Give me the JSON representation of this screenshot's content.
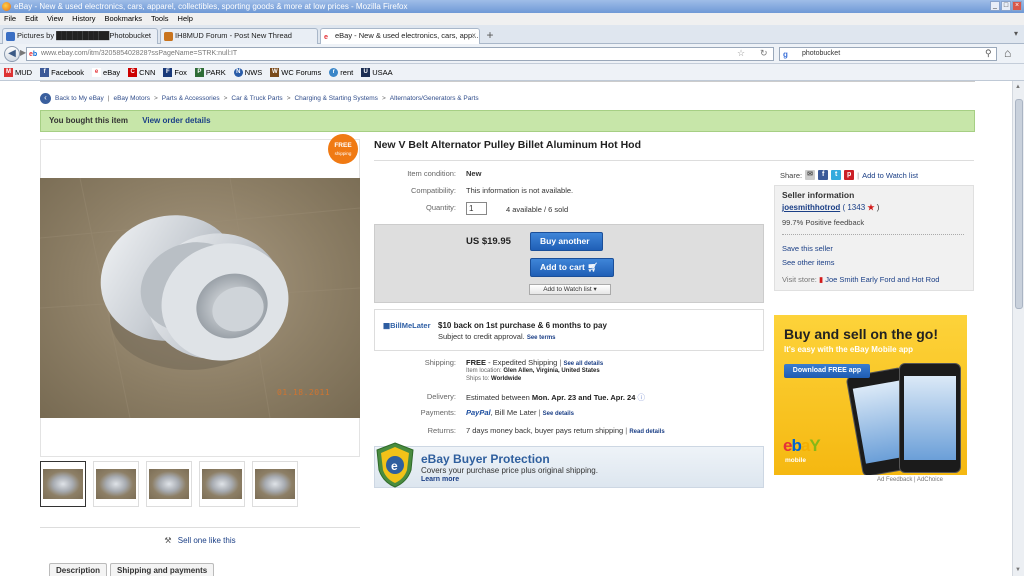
{
  "window": {
    "title": "eBay - New & used electronics, cars, apparel, collectibles, sporting goods & more at low prices - Mozilla Firefox",
    "controls": [
      "_",
      "□",
      "×"
    ]
  },
  "menu": [
    "File",
    "Edit",
    "View",
    "History",
    "Bookmarks",
    "Tools",
    "Help"
  ],
  "tabs": [
    {
      "label": "Pictures by ██████████Photobucket",
      "active": false
    },
    {
      "label": "IH8MUD Forum - Post New Thread",
      "active": false
    },
    {
      "label": "eBay - New & used electronics, cars, app...",
      "active": true
    }
  ],
  "nav": {
    "url": "www.ebay.com/itm/320585402828?ssPageName=STRK:null:IT",
    "search": "photobucket"
  },
  "bookmarks": [
    {
      "label": "MUD",
      "color": "#d33"
    },
    {
      "label": "Facebook",
      "color": "#3b5998"
    },
    {
      "label": "eBay",
      "color": "#e53238"
    },
    {
      "label": "CNN",
      "color": "#cc0000"
    },
    {
      "label": "Fox",
      "color": "#1a3a7a"
    },
    {
      "label": "PARK",
      "color": "#2e6c36"
    },
    {
      "label": "NWS",
      "color": "#2a5ca8"
    },
    {
      "label": "WC Forums",
      "color": "#7a4a1a"
    },
    {
      "label": "rent",
      "color": "#3a86c8"
    },
    {
      "label": "USAA",
      "color": "#1b2d52"
    }
  ],
  "breadcrumb": {
    "back": "Back to My eBay",
    "items": [
      "eBay Motors",
      "Parts & Accessories",
      "Car & Truck Parts",
      "Charging & Starting Systems",
      "Alternators/Generators & Parts"
    ]
  },
  "banner": {
    "text": "You bought this item",
    "link": "View order details"
  },
  "listing": {
    "title": "New V Belt Alternator Pulley Billet Aluminum Hot Hod",
    "free_badge": {
      "line1": "FREE",
      "line2": "shipping"
    },
    "image_stamp": "01.18.2011",
    "item_condition": {
      "label": "Item condition:",
      "value": "New"
    },
    "compatibility": {
      "label": "Compatibility:",
      "value": "This information is not available."
    },
    "quantity": {
      "label": "Quantity:",
      "value": "1",
      "available": "4 available / 6 sold"
    },
    "price": "US $19.95",
    "buttons": {
      "buy_another": "Buy another",
      "add_to_cart": "Add to cart",
      "watch": "Add to Watch list"
    },
    "bml": {
      "logo": "BillMeLater",
      "offer": "$10 back on 1st purchase & 6 months to pay",
      "sub": "Subject to credit approval.",
      "terms": "See terms"
    },
    "shipping": {
      "label": "Shipping:",
      "value": "FREE",
      "method": "- Expedited Shipping",
      "details_link": "See all details",
      "location_label": "Item location:",
      "location": "Glen Allen, Virginia, United States",
      "ships_to_label": "Ships to:",
      "ships_to": "Worldwide"
    },
    "delivery": {
      "label": "Delivery:",
      "prefix": "Estimated between",
      "range": "Mon. Apr. 23 and Tue. Apr. 24"
    },
    "payments": {
      "label": "Payments:",
      "paypal": "PayPal",
      "others": ", Bill Me Later",
      "details_link": "See details"
    },
    "returns": {
      "label": "Returns:",
      "value": "7 days money back, buyer pays return shipping",
      "link": "Read details"
    },
    "protection": {
      "title": "eBay Buyer Protection",
      "sub": "Covers your purchase price plus original shipping.",
      "link": "Learn more"
    },
    "sell_one": "Sell one like this",
    "desc_tabs": [
      "Description",
      "Shipping and payments"
    ],
    "thumbnail_count": 5
  },
  "share": {
    "label": "Share:",
    "watch": "Add to Watch list"
  },
  "seller": {
    "heading": "Seller information",
    "name": "joesmithhotrod",
    "score": "( 1343",
    "score_close": ")",
    "feedback": "99.7% Positive feedback",
    "save": "Save this seller",
    "other": "See other items",
    "visit_label": "Visit store:",
    "store": "Joe Smith Early Ford and Hot Rod"
  },
  "ad": {
    "title": "Buy and sell on the go!",
    "sub": "It's easy with the eBay Mobile app",
    "button": "Download FREE app",
    "logo_e": "e",
    "logo_b": "b",
    "logo_a": "a",
    "logo_y": "Y",
    "mobile": "mobile",
    "feedback": "Ad Feedback | AdChoice"
  },
  "colors": {
    "ebay_red": "#e53238",
    "ebay_blue": "#0064d2",
    "link": "#1b3f86",
    "banner_green": "#c7e6a9"
  }
}
